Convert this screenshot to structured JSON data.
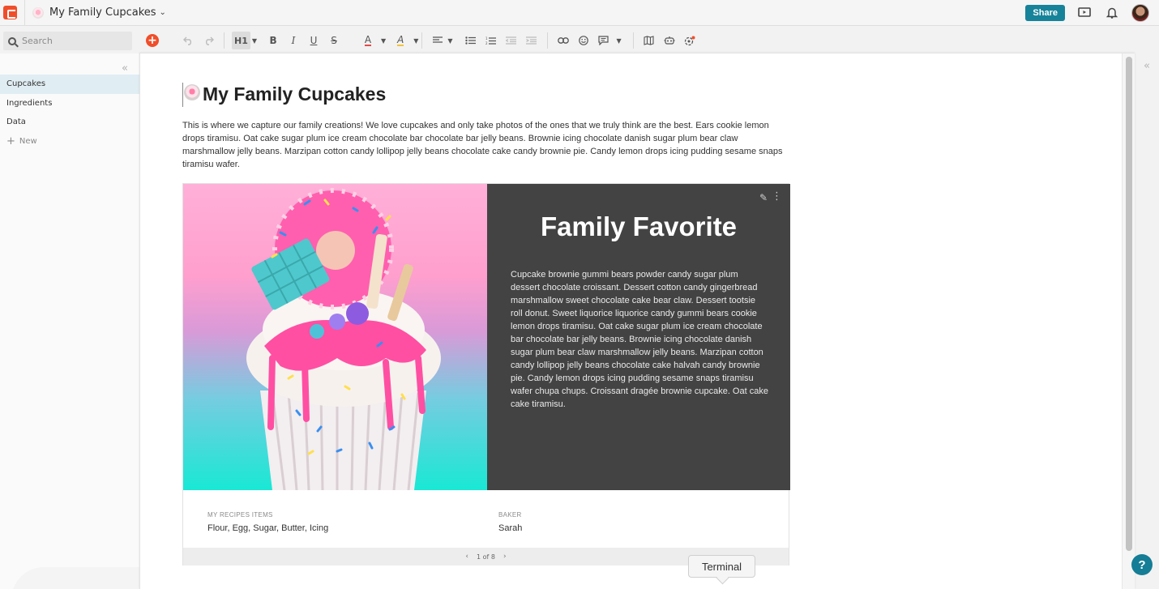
{
  "topbar": {
    "doc_title": "My Family Cupcakes",
    "share_label": "Share",
    "colors": {
      "logo": "#f04e2a",
      "share": "#17839a"
    }
  },
  "search": {
    "placeholder": "Search"
  },
  "toolbar": {
    "heading_label": "H1",
    "bold": "B",
    "italic": "I",
    "underline": "U",
    "strike": "S",
    "font_color": "A",
    "highlight": "A"
  },
  "sidebar": {
    "pages": [
      {
        "label": "Cupcakes",
        "selected": true
      },
      {
        "label": "Ingredients",
        "selected": false
      },
      {
        "label": "Data",
        "selected": false
      }
    ],
    "new_label": "New"
  },
  "doc": {
    "title": "My Family Cupcakes",
    "intro": "This is where we capture our family creations! We love cupcakes and only take photos of the ones that we truly think are the best.  Ears cookie lemon drops tiramisu. Oat cake sugar plum ice cream chocolate bar chocolate bar jelly beans. Brownie icing chocolate danish sugar plum bear claw marshmallow jelly beans. Marzipan cotton candy lollipop jelly beans chocolate cake candy brownie pie. Candy lemon drops icing pudding sesame snaps tiramisu wafer."
  },
  "card": {
    "title": "Family Favorite",
    "body": "Cupcake brownie gummi bears powder candy sugar plum dessert chocolate croissant. Dessert cotton candy gingerbread marshmallow sweet chocolate cake bear claw. Dessert tootsie roll donut. Sweet liquorice liquorice candy gummi bears cookie lemon drops tiramisu. Oat cake sugar plum ice cream chocolate bar chocolate bar jelly beans. Brownie icing chocolate danish sugar plum bear claw marshmallow jelly beans. Marzipan cotton candy lollipop jelly beans chocolate cake halvah candy brownie pie. Candy lemon drops icing pudding sesame snaps tiramisu wafer chupa chups. Croissant dragée brownie cupcake. Oat cake cake tiramisu.",
    "meta": [
      {
        "label": "MY RECIPES ITEMS",
        "value": "Flour, Egg, Sugar, Butter, Icing"
      },
      {
        "label": "BAKER",
        "value": "Sarah"
      }
    ],
    "pager": "1 of 8",
    "dark_bg": "#434343"
  },
  "tooltip": {
    "label": "Terminal"
  },
  "help": {
    "label": "?"
  }
}
